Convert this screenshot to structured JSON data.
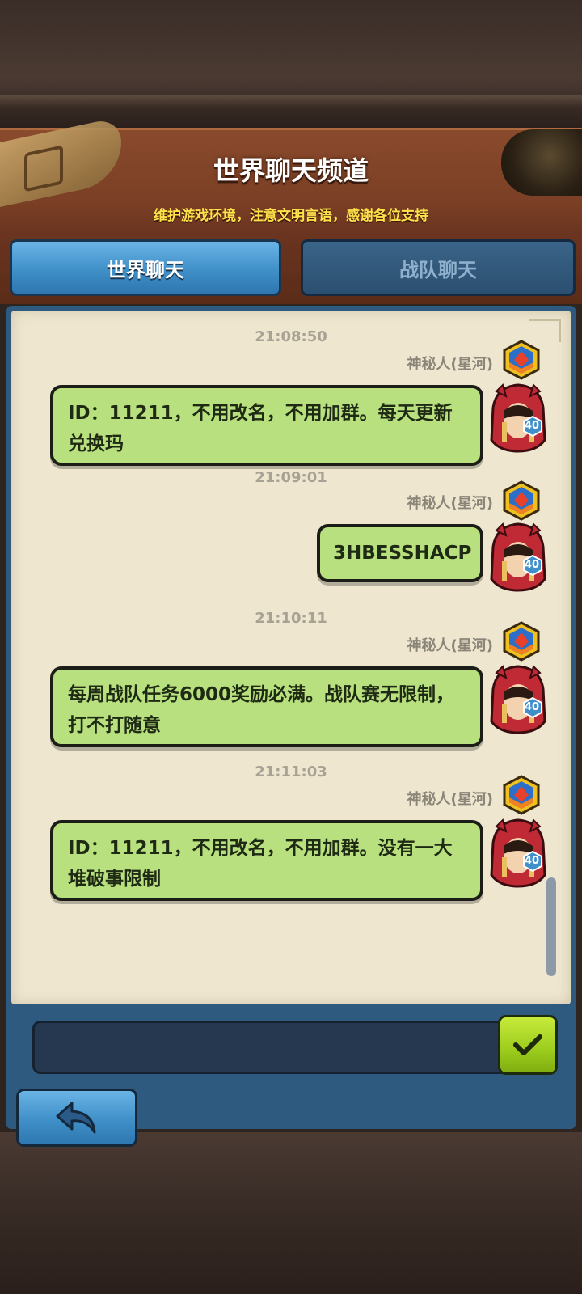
{
  "header": {
    "title": "世界聊天频道",
    "subtitle": "维护游戏环境，注意文明言语，感谢各位支持"
  },
  "tabs": [
    {
      "label": "世界聊天",
      "active": true
    },
    {
      "label": "战队聊天",
      "active": false
    }
  ],
  "messages": [
    {
      "timestamp": "21:08:50",
      "sender": "神秘人(星河)",
      "text": "ID：11211，不用改名，不用加群。每天更新兑换玛",
      "level": "40"
    },
    {
      "timestamp": "21:09:01",
      "sender": "神秘人(星河)",
      "text": "3HBESSHACP",
      "level": "40"
    },
    {
      "timestamp": "21:10:11",
      "sender": "神秘人(星河)",
      "text": "每周战队任务6000奖励必满。战队赛无限制，打不打随意",
      "level": "40"
    },
    {
      "timestamp": "21:11:03",
      "sender": "神秘人(星河)",
      "text": "ID：11211，不用改名，不用加群。没有一大堆破事限制",
      "level": "40"
    }
  ],
  "input": {
    "value": "",
    "placeholder": ""
  },
  "icons": {
    "send": "checkmark-icon",
    "back": "back-arrow-icon",
    "rank_badge": "shield-rank-icon",
    "avatar": "red-hood-avatar"
  },
  "colors": {
    "bubble": "#b9e07e",
    "active_tab": "#3f8fc8",
    "inactive_tab": "#2b4f70",
    "subtitle": "#ffe14a",
    "send_button": "#9ccc1c"
  }
}
